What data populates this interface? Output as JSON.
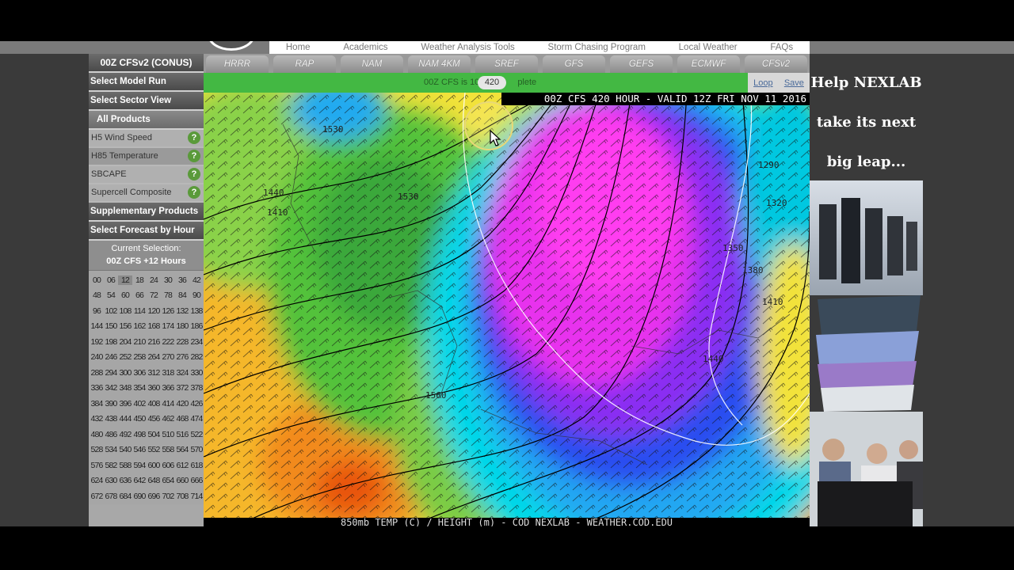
{
  "nav": {
    "items": [
      "Home",
      "Academics",
      "Weather Analysis Tools",
      "Storm Chasing Program",
      "Local Weather",
      "FAQs"
    ]
  },
  "sidebar": {
    "model_run_title": "00Z CFSv2 (CONUS)",
    "select_model_run": "Select Model Run",
    "select_sector_view": "Select Sector View",
    "all_products": "All Products",
    "products": [
      "H5 Wind Speed",
      "H85 Temperature",
      "SBCAPE",
      "Supercell Composite"
    ],
    "selected_product": "H85 Temperature",
    "supplementary_products": "Supplementary Products",
    "select_forecast_by_hour": "Select Forecast by Hour",
    "current_selection_label": "Current Selection:",
    "current_selection_value": "00Z CFS +12 Hours",
    "hours": [
      [
        "00",
        "06",
        "12",
        "18",
        "24",
        "30",
        "36",
        "42"
      ],
      [
        "48",
        "54",
        "60",
        "66",
        "72",
        "78",
        "84",
        "90"
      ],
      [
        "96",
        "102",
        "108",
        "114",
        "120",
        "126",
        "132",
        "138"
      ],
      [
        "144",
        "150",
        "156",
        "162",
        "168",
        "174",
        "180",
        "186"
      ],
      [
        "192",
        "198",
        "204",
        "210",
        "216",
        "222",
        "228",
        "234"
      ],
      [
        "240",
        "246",
        "252",
        "258",
        "264",
        "270",
        "276",
        "282"
      ],
      [
        "288",
        "294",
        "300",
        "306",
        "312",
        "318",
        "324",
        "330"
      ],
      [
        "336",
        "342",
        "348",
        "354",
        "360",
        "366",
        "372",
        "378"
      ],
      [
        "384",
        "390",
        "396",
        "402",
        "408",
        "414",
        "420",
        "426"
      ],
      [
        "432",
        "438",
        "444",
        "450",
        "456",
        "462",
        "468",
        "474"
      ],
      [
        "480",
        "486",
        "492",
        "498",
        "504",
        "510",
        "516",
        "522"
      ],
      [
        "528",
        "534",
        "540",
        "546",
        "552",
        "558",
        "564",
        "570"
      ],
      [
        "576",
        "582",
        "588",
        "594",
        "600",
        "606",
        "612",
        "618"
      ],
      [
        "624",
        "630",
        "636",
        "642",
        "648",
        "654",
        "660",
        "666"
      ],
      [
        "672",
        "678",
        "684",
        "690",
        "696",
        "702",
        "708",
        "714"
      ]
    ],
    "selected_hour": "12"
  },
  "model_tabs": [
    "HRRR",
    "RAP",
    "NAM",
    "NAM 4KM",
    "SREF",
    "GFS",
    "GEFS",
    "ECMWF",
    "CFSv2"
  ],
  "status": {
    "text": "00Z CFS is 10",
    "text_tail": "plete",
    "hour_tooltip": "420",
    "loop_label": "Loop",
    "save_label": "Save"
  },
  "map": {
    "header": "00Z CFS 420 HOUR - VALID 12Z FRI NOV 11 2016",
    "footer": "850mb TEMP (C) / HEIGHT (m) - COD NEXLAB - WEATHER.COD.EDU",
    "contour_labels": [
      "1530",
      "1440",
      "1410",
      "1350",
      "1380",
      "1410",
      "1440",
      "1290",
      "1320",
      "1530",
      "1560"
    ]
  },
  "ad": {
    "line1": "Help NEXLAB",
    "line2": "take its next",
    "line3": "big leap..."
  },
  "colors": {
    "status_green": "#43b843",
    "sidebar_gray": "#a8a8a8",
    "help_green": "#5a9a3a"
  }
}
